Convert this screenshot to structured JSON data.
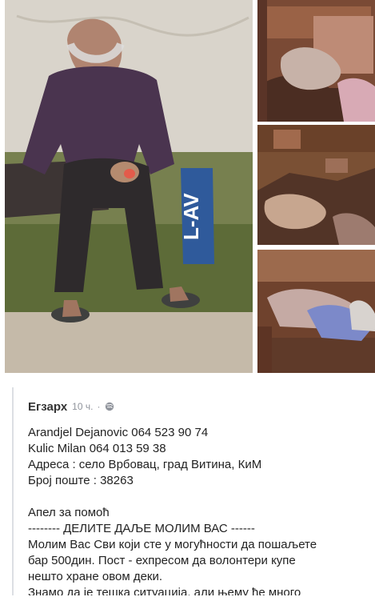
{
  "post": {
    "author": "Егзарх",
    "time": "10 ч.",
    "separator": "·",
    "lines": [
      "Arandjel Dejanovic 064 523 90 74",
      "Kulic Milan 064 013 59 38",
      "Адреса : село Врбовац, град Витина, КиМ",
      "Број поште : 38263",
      "",
      "Апел за помоћ",
      "-------- ДЕЛИТЕ ДАЉЕ МОЛИМ ВАС ------",
      "Молим Вас Сви који сте у могућности да пошаљете",
      "бар 500дин. Пост - ехпресом да волонтери купе",
      "нешто хране овом деки.",
      "Знамо да је тешка ситуација, али њему ће много"
    ]
  },
  "photos": {
    "main_alt": "",
    "side_1_alt": "",
    "side_2_alt": "",
    "side_3_alt": "",
    "crate_text": "L-AV"
  },
  "icons": {
    "audience": "globe-icon"
  }
}
